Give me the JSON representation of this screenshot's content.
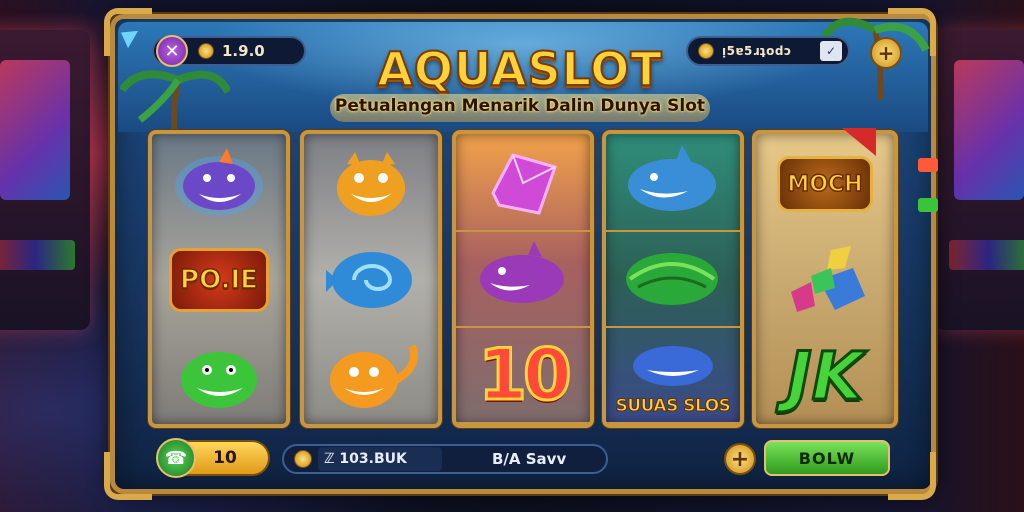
{
  "colors": {
    "frame_gold": "#c9963f",
    "title_yellow": "#ffd23a",
    "panel_blue": "#1d4d86",
    "spin_green": "#2f9a1f"
  },
  "header": {
    "balance": "1.9.0",
    "shop_label": "ᴉ5ɐ5ɹʇodɔ",
    "title": "AQUASLOT",
    "subtitle": "Petualangan Menarik Dalin Dunya Slot"
  },
  "reels": [
    {
      "symbols": [
        {
          "name": "purple-shark",
          "text": ""
        },
        {
          "name": "poie-badge",
          "text": "PO.IE"
        },
        {
          "name": "green-fish",
          "text": ""
        }
      ]
    },
    {
      "symbols": [
        {
          "name": "orange-fish",
          "text": ""
        },
        {
          "name": "blue-swirl-fish",
          "text": ""
        },
        {
          "name": "orange-cat-fish",
          "text": ""
        }
      ]
    },
    {
      "symbols": [
        {
          "name": "pink-gem",
          "text": ""
        },
        {
          "name": "purple-fish",
          "text": ""
        },
        {
          "name": "ten-symbol",
          "text": "10"
        }
      ]
    },
    {
      "symbols": [
        {
          "name": "blue-shark",
          "text": ""
        },
        {
          "name": "green-shell",
          "text": ""
        },
        {
          "name": "suuas-slos-badge",
          "text": "SUUAS SLOS"
        }
      ]
    },
    {
      "symbols": [
        {
          "name": "moch-badge",
          "text": "MOCH"
        },
        {
          "name": "gem-cluster",
          "text": ""
        },
        {
          "name": "jk-symbol",
          "text": "JK"
        }
      ]
    }
  ],
  "footer": {
    "bet_value": "10",
    "win_amount": "ℤ 103.BUK",
    "win_label": "B/A Savv",
    "spin_label": "BOLW"
  },
  "icons": [
    "close-x-icon",
    "coin-icon",
    "shop-icon",
    "check-icon",
    "plus-icon",
    "phone-icon",
    "back-arrow-icon"
  ]
}
